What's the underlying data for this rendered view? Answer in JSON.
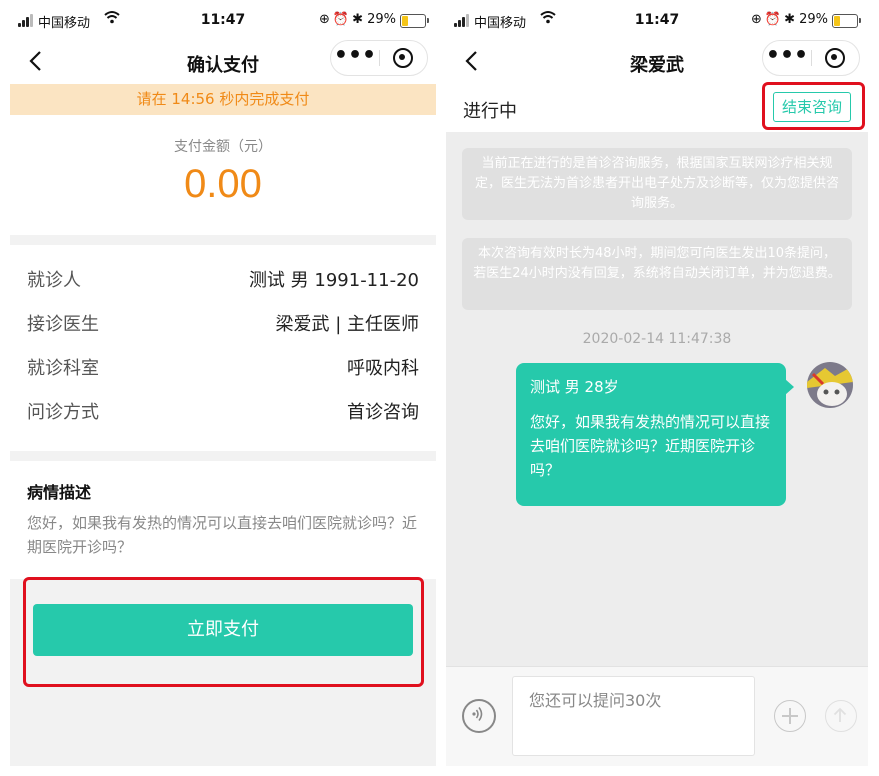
{
  "left": {
    "status_bar": {
      "carrier": "中国移动",
      "time": "11:47",
      "battery": "29%",
      "battery_level": 0.29
    },
    "nav": {
      "title": "确认支付"
    },
    "countdown": "请在 14:56 秒内完成支付",
    "amount": {
      "label": "支付金额（元）",
      "value": "0.00"
    },
    "info": [
      {
        "label": "就诊人",
        "value": "测试 男 1991-11-20"
      },
      {
        "label": "接诊医生",
        "value": "梁爱武 | 主任医师"
      },
      {
        "label": "就诊科室",
        "value": "呼吸内科"
      },
      {
        "label": "问诊方式",
        "value": "首诊咨询"
      }
    ],
    "description": {
      "title": "病情描述",
      "text": "您好，如果我有发热的情况可以直接去咱们医院就诊吗？近期医院开诊吗？"
    },
    "pay_button": "立即支付"
  },
  "right": {
    "status_bar": {
      "carrier": "中国移动",
      "time": "11:47",
      "battery": "29%",
      "battery_level": 0.29
    },
    "nav": {
      "title": "梁爱武"
    },
    "status": "进行中",
    "end_button": "结束咨询",
    "system_messages": [
      "当前正在进行的是首诊咨询服务，根据国家互联网诊疗相关规定，医生无法为首诊患者开出电子处方及诊断等，仅为您提供咨询服务。",
      "本次咨询有效时长为48小时，期间您可向医生发出10条提问，若医生24小时内没有回复，系统将自动关闭订单，并为您退费。"
    ],
    "message_time": "2020-02-14 11:47:38",
    "message": {
      "header": "测试 男 28岁",
      "body": "您好，如果我有发热的情况可以直接去咱们医院就诊吗？近期医院开诊吗？"
    },
    "input_placeholder": "您还可以提问30次"
  },
  "colors": {
    "accent": "#26c9ab",
    "orange": "#f08a17",
    "highlight": "#e0101e"
  },
  "icons": [
    "back-chevron-icon",
    "more-icon",
    "close-mini-program-icon",
    "voice-icon",
    "plus-icon",
    "send-icon",
    "wifi-icon",
    "battery-icon"
  ]
}
